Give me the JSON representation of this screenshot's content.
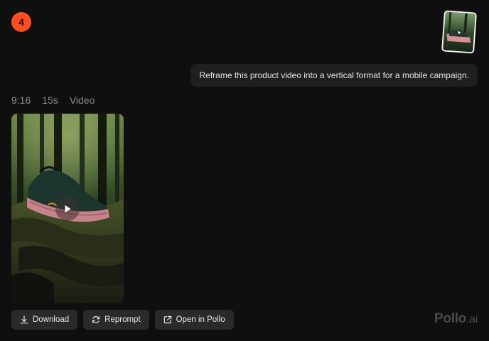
{
  "step": {
    "number": "4"
  },
  "attachment": {
    "icon": "video-thumbnail"
  },
  "prompt": {
    "text": "Reframe this product video into a vertical format for a mobile campaign."
  },
  "meta": {
    "aspect_ratio": "9:16",
    "duration": "15s",
    "type": "Video"
  },
  "video": {
    "icon": "play-icon"
  },
  "actions": {
    "download_label": "Download",
    "reprompt_label": "Reprompt",
    "open_label": "Open in Pollo"
  },
  "brand": {
    "name": "Pollo",
    "suffix": ".ai"
  },
  "colors": {
    "accent": "#ff4d1f",
    "background": "#0f0f0f",
    "bubble": "#1f1f1f",
    "button": "#2a2a2a"
  }
}
